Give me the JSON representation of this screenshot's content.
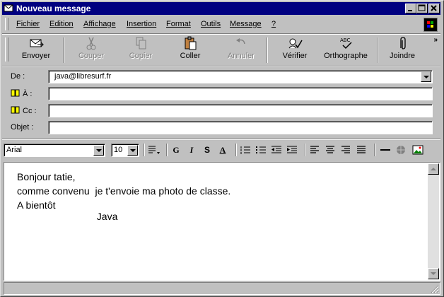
{
  "window": {
    "title": "Nouveau message"
  },
  "menu": {
    "items": [
      {
        "label": "Fichier"
      },
      {
        "label": "Edition"
      },
      {
        "label": "Affichage"
      },
      {
        "label": "Insertion"
      },
      {
        "label": "Format"
      },
      {
        "label": "Outils"
      },
      {
        "label": "Message"
      },
      {
        "label": "?"
      }
    ]
  },
  "toolbar": {
    "buttons": [
      {
        "label": "Envoyer",
        "icon": "send-icon",
        "enabled": true
      },
      {
        "label": "Couper",
        "icon": "scissors-icon",
        "enabled": false
      },
      {
        "label": "Copier",
        "icon": "copy-icon",
        "enabled": false
      },
      {
        "label": "Coller",
        "icon": "paste-icon",
        "enabled": true
      },
      {
        "label": "Annuler",
        "icon": "undo-icon",
        "enabled": false
      },
      {
        "label": "Vérifier",
        "icon": "check-names-icon",
        "enabled": true
      },
      {
        "label": "Orthographe",
        "icon": "spelling-icon",
        "enabled": true
      },
      {
        "label": "Joindre",
        "icon": "paperclip-icon",
        "enabled": true
      }
    ],
    "more": "»"
  },
  "header": {
    "from_label": "De :",
    "from_value": "java@libresurf.fr",
    "to_label": "À :",
    "to_value": "",
    "cc_label": "Cc :",
    "cc_value": "",
    "subject_label": "Objet :",
    "subject_value": ""
  },
  "format": {
    "font": "Arial",
    "size": "10",
    "bold": "G",
    "italic": "I",
    "underline": "S",
    "font_color": "A"
  },
  "message": {
    "lines": [
      "Bonjour tatie,",
      "comme convenu  je t'envoie ma photo de classe.",
      "A bientôt",
      "                             Java"
    ]
  },
  "colors": {
    "titlebar": "#000080",
    "face": "#c0c0c0"
  }
}
